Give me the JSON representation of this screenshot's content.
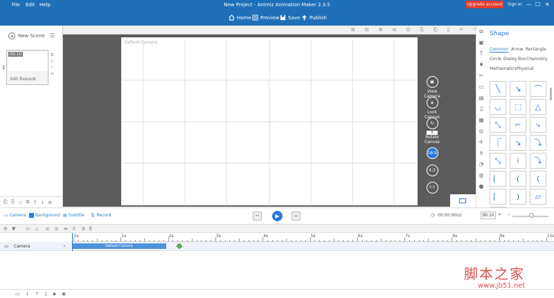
{
  "menu": {
    "file": "File",
    "edit": "Edit",
    "help": "Help"
  },
  "app_title": "New Project - Animiz Animation Maker 2.3.5",
  "toolbar": {
    "home": "Home",
    "preview": "Preview",
    "save": "Save",
    "publish": "Publish"
  },
  "account": {
    "upgrade": "Upgrade account",
    "signin": "Sign In"
  },
  "window_controls": [
    "—",
    "☐",
    "✕"
  ],
  "scenes": {
    "new_label": "New Scene",
    "items": [
      {
        "number": "1",
        "duration": "00:10",
        "remark": "Add Remark"
      }
    ]
  },
  "stage": {
    "camera_label": "Default Camera",
    "view_camera": "View Camera",
    "lock_canvas": "Lock Canvas",
    "rotate_value": "0",
    "rotate_canvas": "Rotate Canvas",
    "ratio_169": "16:9",
    "ratio_43": "4:3",
    "ratio_custom": "?:?"
  },
  "shape_panel": {
    "title": "Shape",
    "tabs": [
      "Common",
      "Arrow",
      "Rectangle",
      "Circle",
      "Dialog Box",
      "Chemistry",
      "Mathematics",
      "Physical"
    ],
    "active_tab": "Common",
    "cell_glyphs": [
      "╲",
      "↘",
      "⌒",
      "◡",
      "⬚",
      "△",
      "⤡",
      "⌐",
      "⤷",
      "⎾",
      "↘",
      "⤵",
      "⤡",
      "⟊",
      "⤵",
      "⎸",
      "(",
      "(",
      "⎸",
      ")",
      "▱",
      "⏢"
    ]
  },
  "play_bar": {
    "camera": "Camera",
    "background": "Background",
    "subtitle": "Subtitle",
    "record": "Record",
    "time": "00:00:00(s)",
    "duration": "00:10"
  },
  "timeline": {
    "ticks": [
      "0s",
      "1s",
      "2s",
      "3s",
      "4s",
      "5s",
      "6s",
      "7s",
      "8s",
      "9s",
      "10s"
    ],
    "track": "Camera",
    "clip": "Default Camera"
  },
  "watermark": {
    "cn": "脚本之家",
    "url": "www.jb51.net"
  }
}
